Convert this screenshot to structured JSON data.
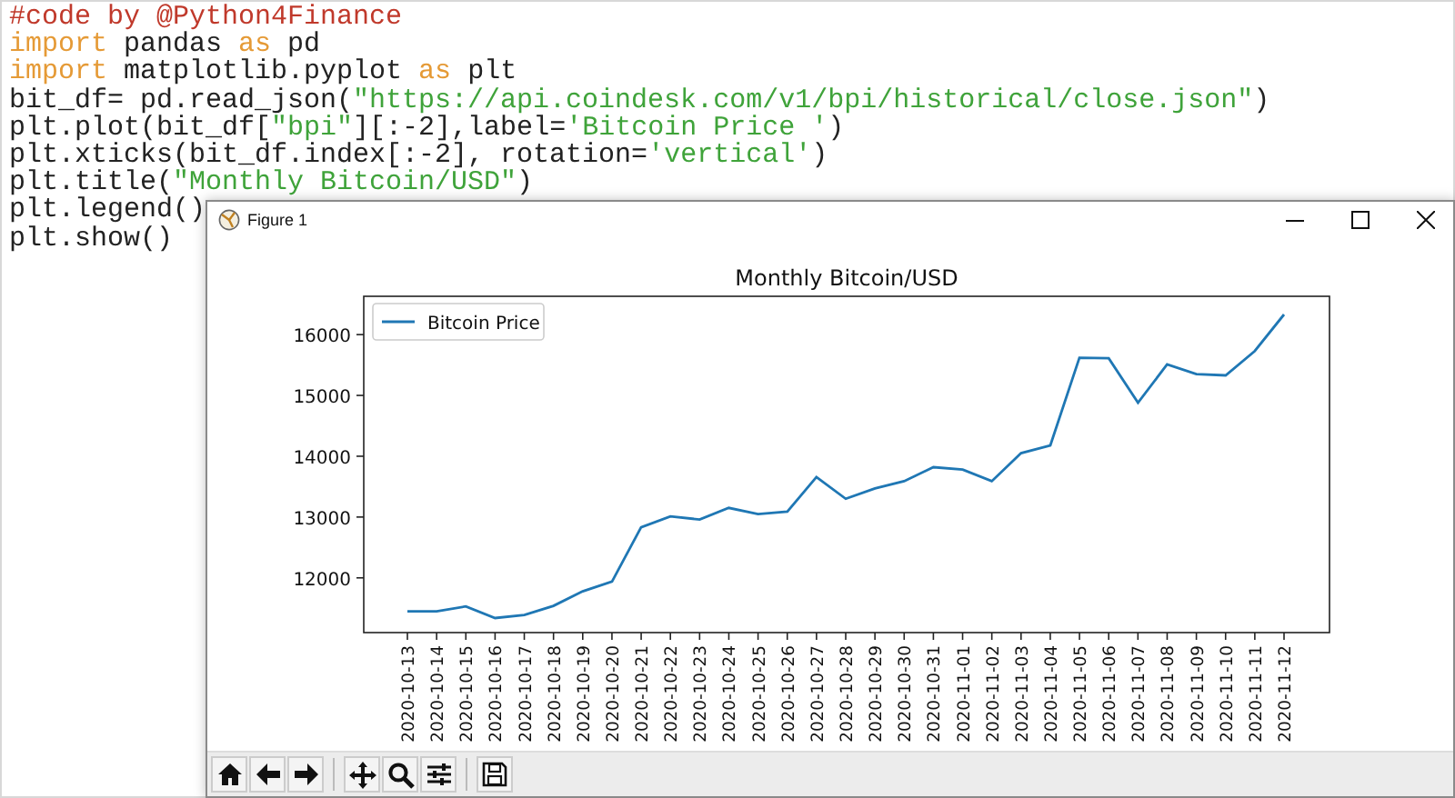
{
  "editor": {
    "lines": [
      [
        {
          "kind": "comment",
          "text": "#code by @Python4Finance"
        }
      ],
      [
        {
          "kind": "keyword",
          "text": "import"
        },
        {
          "kind": "plain",
          "text": " pandas "
        },
        {
          "kind": "keyword",
          "text": "as"
        },
        {
          "kind": "plain",
          "text": " pd"
        }
      ],
      [
        {
          "kind": "keyword",
          "text": "import"
        },
        {
          "kind": "plain",
          "text": " matplotlib.pyplot "
        },
        {
          "kind": "keyword",
          "text": "as"
        },
        {
          "kind": "plain",
          "text": " plt"
        }
      ],
      [
        {
          "kind": "plain",
          "text": "bit_df= pd.read_json("
        },
        {
          "kind": "string",
          "text": "\"https://api.coindesk.com/v1/bpi/historical/close.json\""
        },
        {
          "kind": "plain",
          "text": ")"
        }
      ],
      [
        {
          "kind": "plain",
          "text": "plt.plot(bit_df["
        },
        {
          "kind": "string",
          "text": "\"bpi\""
        },
        {
          "kind": "plain",
          "text": "][:-2],label="
        },
        {
          "kind": "string",
          "text": "'Bitcoin Price '"
        },
        {
          "kind": "plain",
          "text": ")"
        }
      ],
      [
        {
          "kind": "plain",
          "text": "plt.xticks(bit_df.index[:-2], rotation="
        },
        {
          "kind": "string",
          "text": "'vertical'"
        },
        {
          "kind": "plain",
          "text": ")"
        }
      ],
      [
        {
          "kind": "plain",
          "text": "plt.title("
        },
        {
          "kind": "string",
          "text": "\"Monthly Bitcoin/USD\""
        },
        {
          "kind": "plain",
          "text": ")"
        }
      ],
      [
        {
          "kind": "plain",
          "text": "plt.legend()"
        }
      ],
      [
        {
          "kind": "plain",
          "text": "plt.show()"
        }
      ]
    ]
  },
  "figure_window": {
    "title": "Figure 1",
    "chart_data": {
      "type": "line",
      "title": "Monthly Bitcoin/USD",
      "categories": [
        "2020-10-13",
        "2020-10-14",
        "2020-10-15",
        "2020-10-16",
        "2020-10-17",
        "2020-10-18",
        "2020-10-19",
        "2020-10-20",
        "2020-10-21",
        "2020-10-22",
        "2020-10-23",
        "2020-10-24",
        "2020-10-25",
        "2020-10-26",
        "2020-10-27",
        "2020-10-28",
        "2020-10-29",
        "2020-10-30",
        "2020-10-31",
        "2020-11-01",
        "2020-11-02",
        "2020-11-03",
        "2020-11-04",
        "2020-11-05",
        "2020-11-06",
        "2020-11-07",
        "2020-11-08",
        "2020-11-09",
        "2020-11-10",
        "2020-11-11",
        "2020-11-12"
      ],
      "series": [
        {
          "name": "Bitcoin Price",
          "color": "#1f77b4",
          "values": [
            11450,
            11450,
            11530,
            11340,
            11390,
            11540,
            11780,
            11940,
            12830,
            13010,
            12960,
            13150,
            13050,
            13090,
            13660,
            13300,
            13470,
            13590,
            13820,
            13780,
            13590,
            14050,
            14180,
            15620,
            15610,
            14880,
            15510,
            15350,
            15330,
            15730,
            16330
          ]
        }
      ],
      "ylim": [
        11100,
        16630
      ],
      "yticks": [
        12000,
        13000,
        14000,
        15000,
        16000
      ]
    }
  }
}
